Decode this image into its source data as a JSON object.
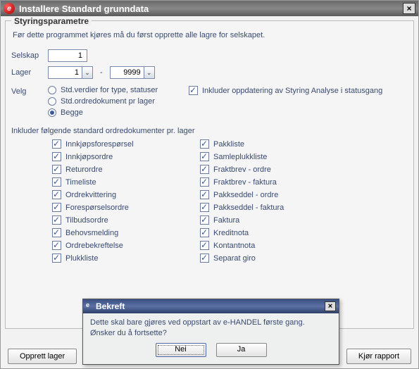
{
  "window": {
    "title": "Installere Standard grunndata",
    "close_glyph": "×"
  },
  "group_title": "Styringsparametre",
  "intro": "Før dette programmet kjøres må du først opprette alle lagre for selskapet.",
  "selskap": {
    "label": "Selskap",
    "value": "1"
  },
  "lager": {
    "label": "Lager",
    "from": "1",
    "to": "9999",
    "dash": "-"
  },
  "velg_label": "Velg",
  "radios": {
    "std_values": "Std.verdier for type, statuser",
    "std_doc": "Std.ordredokument pr lager",
    "begge": "Begge",
    "selected": "begge"
  },
  "inkluder_oppdatering": {
    "label": "Inkluder oppdatering av Styring  Analyse i statusgang",
    "checked": true
  },
  "doc_section": "Inkluder følgende standard ordredokumenter pr. lager",
  "docs_left": [
    "Innkjøpsforespørsel",
    "Innkjøpsordre",
    "Returordre",
    "Timeliste",
    "Ordrekvittering",
    "Forespørselsordre",
    "Tilbudsordre",
    "Behovsmelding",
    "Ordrebekreftelse",
    "Plukkliste"
  ],
  "docs_right": [
    "Pakkliste",
    "Samleplukkliste",
    "Fraktbrev - ordre",
    "Fraktbrev - faktura",
    "Pakkseddel - ordre",
    "Pakkseddel - faktura",
    "Faktura",
    "Kreditnota",
    "Kontantnota",
    "Separat giro"
  ],
  "buttons": {
    "opprett": "Opprett lager",
    "rapport": "Kjør rapport"
  },
  "modal": {
    "title": "Bekreft",
    "close_glyph": "×",
    "body": "Dette skal bare gjøres ved oppstart av e-HANDEL første gang. Ønsker du å fortsette?",
    "no": "Nei",
    "yes": "Ja"
  },
  "logo_glyph": "e"
}
